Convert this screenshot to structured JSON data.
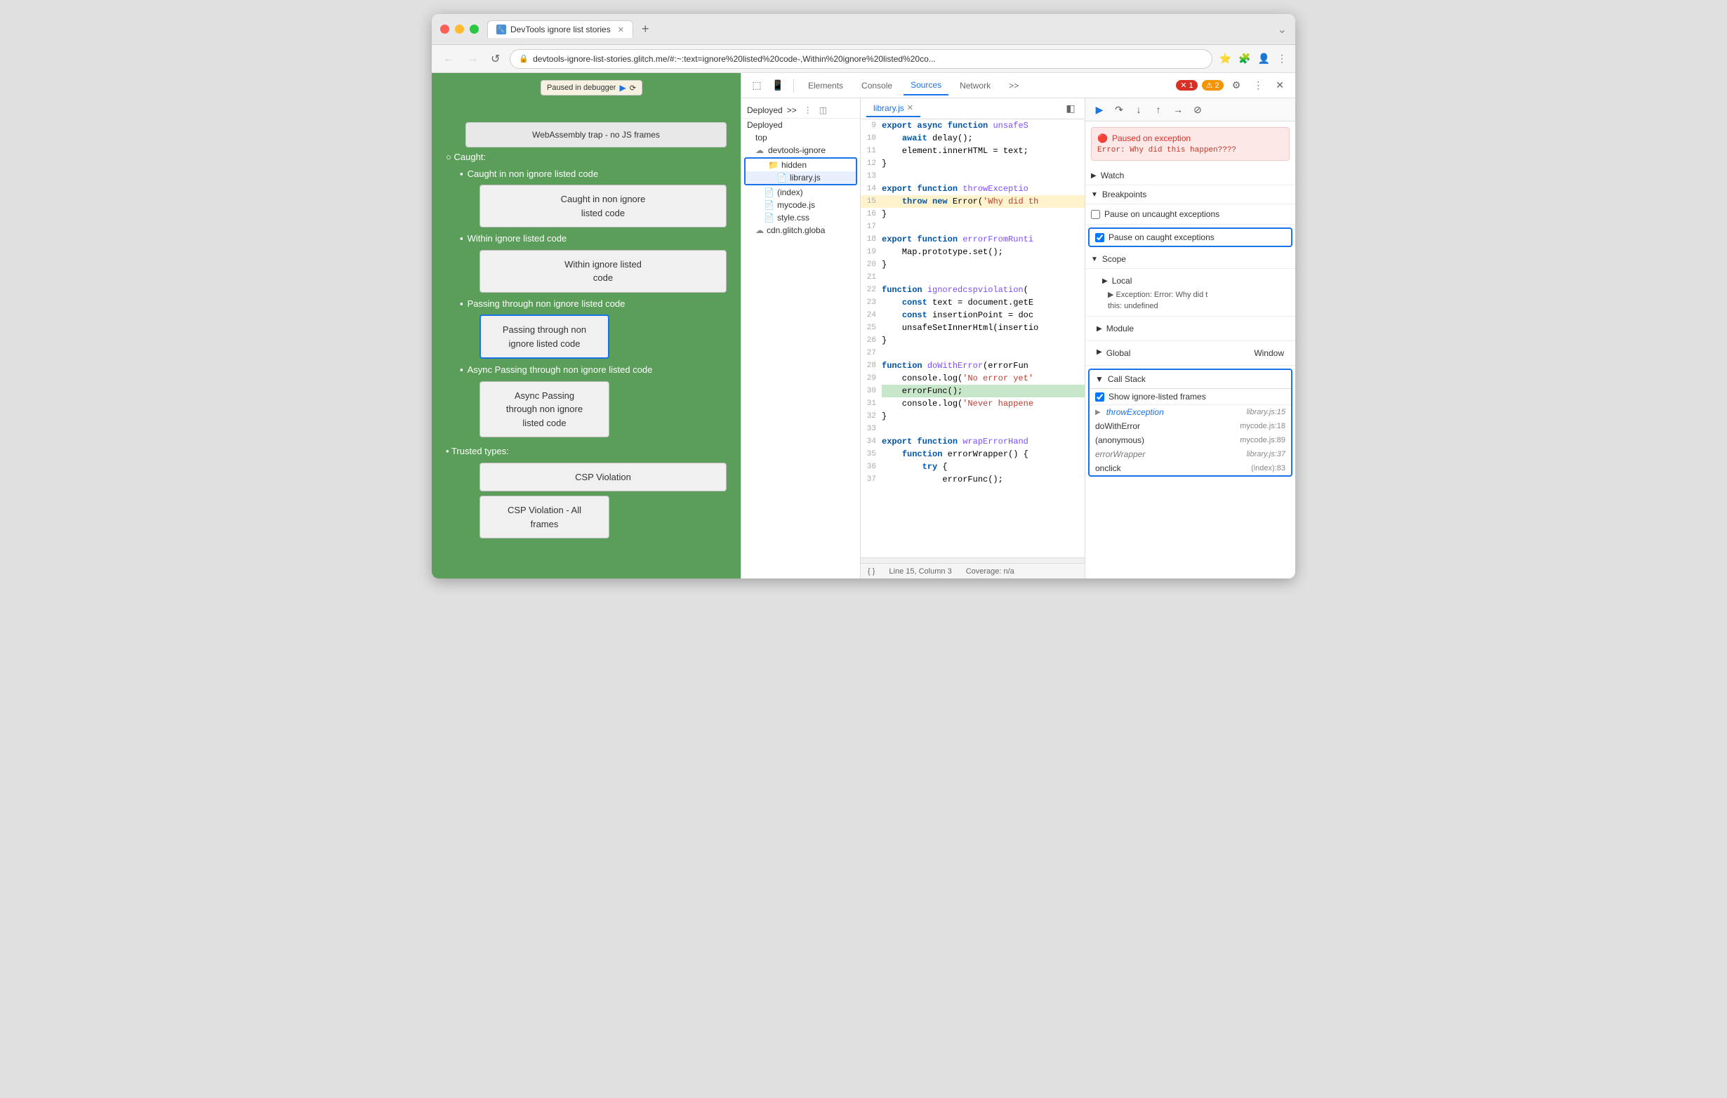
{
  "browser": {
    "tab_title": "DevTools ignore list stories",
    "tab_favicon": "D",
    "url": "devtools-ignore-list-stories.glitch.me/#:~:text=ignore%20listed%20code-,Within%20ignore%20listed%20co...",
    "new_tab_label": "+",
    "chevron": "›"
  },
  "webpage": {
    "paused_label": "Paused in debugger",
    "webassembly_btn": "WebAssembly trap -\nno JS frames",
    "caught_label": "Caught:",
    "items": [
      {
        "label": "Caught in non ignore listed code",
        "btn": "Caught in non ignore\nlisted code"
      },
      {
        "label": "Within ignore listed code",
        "btn": "Within ignore listed\ncode"
      },
      {
        "label": "Passing through non ignore listed code",
        "btn": "Passing through non\nignore listed code",
        "active": true
      },
      {
        "label": "Async Passing through non ignore listed code",
        "btn": "Async Passing\nthrough non ignore\nlisted code"
      }
    ],
    "trusted_types_label": "Trusted types:",
    "csp_btn1": "CSP Violation",
    "csp_btn2": "CSP Violation - All frames"
  },
  "devtools": {
    "tabs": [
      "Elements",
      "Console",
      "Sources",
      "Network",
      ">>"
    ],
    "active_tab": "Sources",
    "error_count": "1",
    "warn_count": "2",
    "file_tree": {
      "deployed_label": "Deployed",
      "top_label": "top",
      "devtools_ignore_label": "devtools-ignore",
      "hidden_label": "hidden",
      "library_js_label": "library.js",
      "index_label": "(index)",
      "mycode_label": "mycode.js",
      "style_label": "style.css",
      "cdn_label": "cdn.glitch.globa"
    },
    "source_file": "library.js",
    "code_lines": [
      {
        "num": "9",
        "content": "export async function unsafeS",
        "highlight": false
      },
      {
        "num": "10",
        "content": "    await delay();",
        "highlight": false
      },
      {
        "num": "11",
        "content": "    element.innerHTML = text;",
        "highlight": false
      },
      {
        "num": "12",
        "content": "}",
        "highlight": false
      },
      {
        "num": "13",
        "content": "",
        "highlight": false
      },
      {
        "num": "14",
        "content": "export function throwExceptio",
        "highlight": false
      },
      {
        "num": "15",
        "content": "    throw new Error('Why did th",
        "highlight": true
      },
      {
        "num": "16",
        "content": "}",
        "highlight": false
      },
      {
        "num": "17",
        "content": "",
        "highlight": false
      },
      {
        "num": "18",
        "content": "export function errorFromRunti",
        "highlight": false
      },
      {
        "num": "19",
        "content": "    Map.prototype.set();",
        "highlight": false
      },
      {
        "num": "20",
        "content": "}",
        "highlight": false
      },
      {
        "num": "21",
        "content": "",
        "highlight": false
      },
      {
        "num": "22",
        "content": "function ignoredcspviolation(",
        "highlight": false
      },
      {
        "num": "23",
        "content": "    const text = document.getE",
        "highlight": false
      },
      {
        "num": "24",
        "content": "    const insertionPoint = doc",
        "highlight": false
      },
      {
        "num": "25",
        "content": "    unsafeSetInnerHtml(insertio",
        "highlight": false
      },
      {
        "num": "26",
        "content": "}",
        "highlight": false
      },
      {
        "num": "27",
        "content": "",
        "highlight": false
      },
      {
        "num": "28",
        "content": "function doWithError(errorFun",
        "highlight": false
      },
      {
        "num": "29",
        "content": "    console.log('No error yet'",
        "highlight": false
      },
      {
        "num": "30",
        "content": "    errorFunc();",
        "highlight": false
      },
      {
        "num": "31",
        "content": "    console.log('Never happene",
        "highlight": false
      },
      {
        "num": "32",
        "content": "}",
        "highlight": false
      },
      {
        "num": "33",
        "content": "",
        "highlight": false
      },
      {
        "num": "34",
        "content": "export function wrapErrorHand",
        "highlight": false
      },
      {
        "num": "35",
        "content": "    function errorWrapper() {",
        "highlight": false
      },
      {
        "num": "36",
        "content": "        try {",
        "highlight": false
      },
      {
        "num": "37",
        "content": "            errorFunc();",
        "highlight": false
      }
    ],
    "status_bar": {
      "line_col": "Line 15, Column 3",
      "coverage": "Coverage: n/a"
    },
    "debugger": {
      "exception_title": "Paused on exception",
      "exception_msg": "Error: Why did this\nhappen????",
      "watch_label": "Watch",
      "breakpoints_label": "Breakpoints",
      "pause_uncaught_label": "Pause on uncaught exceptions",
      "pause_caught_label": "Pause on caught exceptions",
      "scope_label": "Scope",
      "local_label": "Local",
      "exception_var": "Exception: Error: Why did t",
      "this_label": "this:",
      "this_val": "undefined",
      "module_label": "Module",
      "global_label": "Global",
      "global_val": "Window",
      "callstack_label": "Call Stack",
      "show_ignore_label": "Show ignore-listed frames",
      "callstack_items": [
        {
          "fn": "throwException",
          "location": "library.js:15",
          "italic": true,
          "blue": true,
          "arrow": true
        },
        {
          "fn": "doWithError",
          "location": "mycode.js:18",
          "italic": false,
          "blue": false,
          "arrow": false
        },
        {
          "fn": "(anonymous)",
          "location": "mycode.js:89",
          "italic": false,
          "blue": false,
          "arrow": false
        },
        {
          "fn": "errorWrapper",
          "location": "library.js:37",
          "italic": true,
          "blue": false,
          "arrow": false
        },
        {
          "fn": "onclick",
          "location": "(index):83",
          "italic": false,
          "blue": false,
          "arrow": false
        }
      ]
    }
  }
}
